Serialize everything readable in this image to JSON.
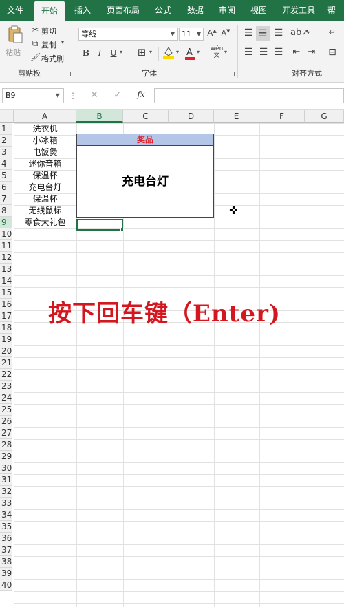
{
  "tabs": [
    {
      "label": "文件",
      "active": false
    },
    {
      "label": "开始",
      "active": true
    },
    {
      "label": "插入",
      "active": false
    },
    {
      "label": "页面布局",
      "active": false
    },
    {
      "label": "公式",
      "active": false
    },
    {
      "label": "数据",
      "active": false
    },
    {
      "label": "审阅",
      "active": false
    },
    {
      "label": "视图",
      "active": false
    },
    {
      "label": "开发工具",
      "active": false
    },
    {
      "label": "帮",
      "active": false
    }
  ],
  "ribbon": {
    "clipboard": {
      "paste_label": "粘贴",
      "cut_label": "剪切",
      "copy_label": "复制",
      "format_painter_label": "格式刷",
      "group_label": "剪贴板"
    },
    "font": {
      "font_name": "等线",
      "font_size": "11",
      "group_label": "字体",
      "font_color": "#e0202a",
      "fill_color": "#ffd700"
    },
    "alignment": {
      "group_label": "对齐方式"
    }
  },
  "formula_bar": {
    "name_box": "B9",
    "fx_label": "fx",
    "value": ""
  },
  "columns": [
    "A",
    "B",
    "C",
    "D",
    "E",
    "F",
    "G"
  ],
  "selected_column": "B",
  "rows": [
    "1",
    "2",
    "3",
    "4",
    "5",
    "6",
    "7",
    "8",
    "9",
    "10",
    "11",
    "12",
    "13",
    "14",
    "15",
    "16",
    "17",
    "18",
    "19",
    "20",
    "21",
    "22",
    "23",
    "24",
    "25",
    "26",
    "27",
    "28",
    "29",
    "30",
    "31",
    "32",
    "33",
    "34",
    "35",
    "36",
    "37",
    "38",
    "39",
    "40"
  ],
  "selected_row": "9",
  "column_a": [
    "洗衣机",
    "小冰箱",
    "电饭煲",
    "迷你音箱",
    "保温杯",
    "充电台灯",
    "保温杯",
    "无线鼠标",
    "零食大礼包"
  ],
  "prize": {
    "header": "奖品",
    "value": "充电台灯",
    "header_color": "#b4c6e7"
  },
  "caption": "按下回车键（Enter)",
  "accent_color": "#217346"
}
